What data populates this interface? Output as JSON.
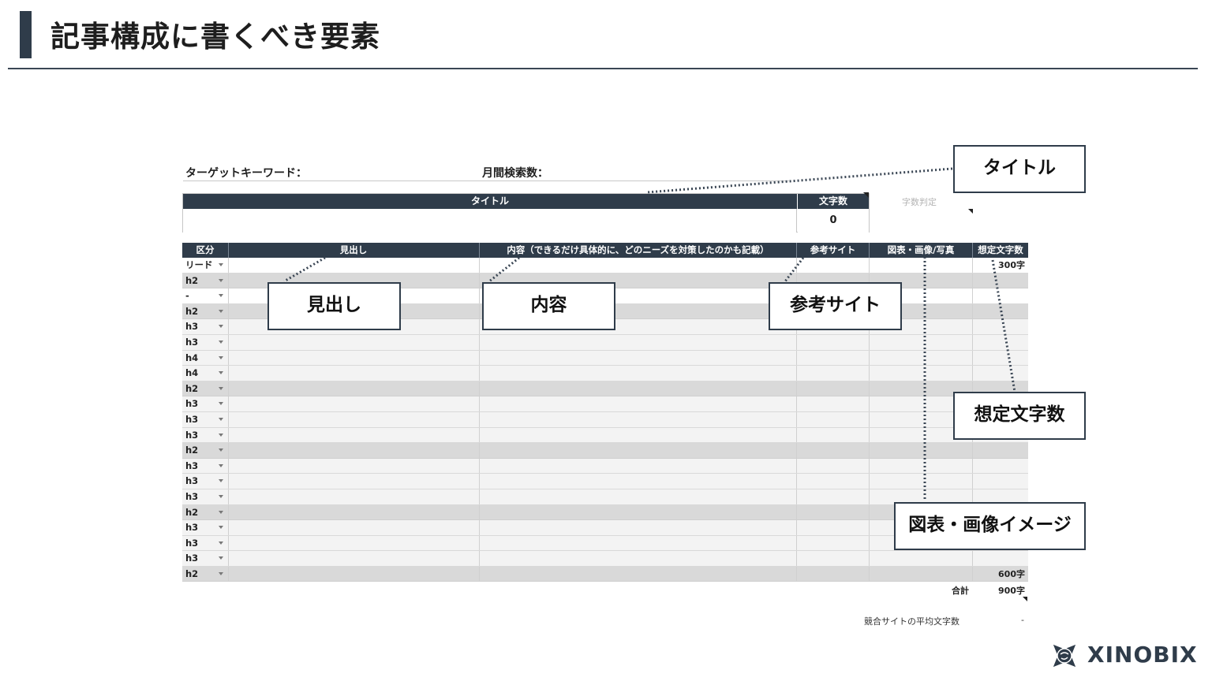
{
  "slide": {
    "title": "記事構成に書くべき要素"
  },
  "sheet": {
    "target_keyword_label": "ターゲットキーワード：",
    "monthly_search_label": "月間検索数：",
    "title_header": "タイトル",
    "char_count_header": "文字数",
    "char_count_value": "0",
    "char_judge_label": "字数判定",
    "columns": {
      "kubun": "区分",
      "heading": "見出し",
      "content": "内容（できるだけ具体的に、どのニーズを対策したのかも記載）",
      "reference": "参考サイト",
      "figure": "図表・画像/写真",
      "expected_chars": "想定文字数"
    },
    "rows": [
      {
        "kubun": "リード",
        "chars": "300字"
      },
      {
        "kubun": "h2",
        "chars": ""
      },
      {
        "kubun": "-",
        "chars": ""
      },
      {
        "kubun": "h2",
        "chars": ""
      },
      {
        "kubun": "h3",
        "chars": ""
      },
      {
        "kubun": "h3",
        "chars": ""
      },
      {
        "kubun": "h4",
        "chars": ""
      },
      {
        "kubun": "h4",
        "chars": ""
      },
      {
        "kubun": "h2",
        "chars": ""
      },
      {
        "kubun": "h3",
        "chars": ""
      },
      {
        "kubun": "h3",
        "chars": ""
      },
      {
        "kubun": "h3",
        "chars": ""
      },
      {
        "kubun": "h2",
        "chars": ""
      },
      {
        "kubun": "h3",
        "chars": ""
      },
      {
        "kubun": "h3",
        "chars": ""
      },
      {
        "kubun": "h3",
        "chars": ""
      },
      {
        "kubun": "h2",
        "chars": ""
      },
      {
        "kubun": "h3",
        "chars": ""
      },
      {
        "kubun": "h3",
        "chars": ""
      },
      {
        "kubun": "h3",
        "chars": ""
      },
      {
        "kubun": "h2",
        "chars": "600字"
      }
    ],
    "total_label": "合計",
    "total_value": "900字",
    "competitor_avg_label": "競合サイトの平均文字数",
    "competitor_avg_value": "-"
  },
  "callouts": {
    "title": "タイトル",
    "heading": "見出し",
    "content": "内容",
    "reference": "参考サイト",
    "expected_chars": "想定文字数",
    "figure": "図表・画像イメージ"
  },
  "brand": {
    "name": "XINOBIX",
    "mark_icon": "ninja-star-logo-icon"
  },
  "colors": {
    "navy": "#2f3c4a",
    "h2_row": "#d9d9d9",
    "h3_row": "#f3f3f3"
  }
}
